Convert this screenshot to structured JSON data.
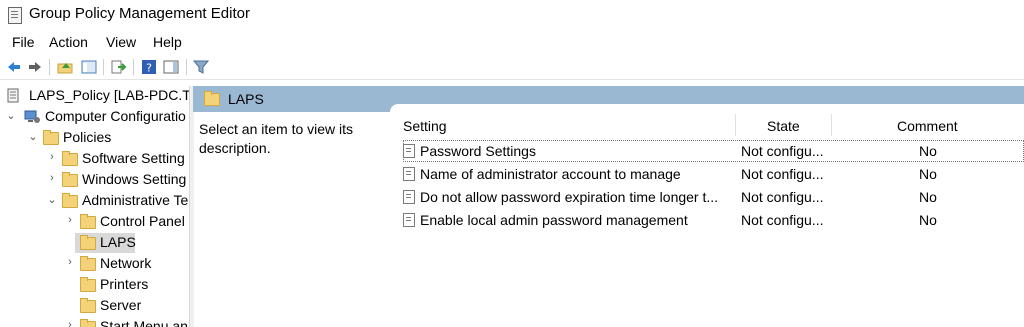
{
  "window": {
    "title": "Group Policy Management Editor"
  },
  "menu": [
    "File",
    "Action",
    "View",
    "Help"
  ],
  "toolbar": {
    "icons": [
      "back-arrow-icon",
      "forward-arrow-icon",
      "up-folder-icon",
      "show-hide-tree-icon",
      "export-list-icon",
      "help-icon",
      "show-hide-action-pane-icon",
      "filter-icon"
    ]
  },
  "tree": {
    "items": [
      {
        "label": "LAPS_Policy [LAB-PDC.TH",
        "chevron": ""
      },
      {
        "label": "Computer Configuratio",
        "chevron": "⌄"
      },
      {
        "label": "Policies",
        "chevron": "⌄"
      },
      {
        "label": "Software Setting",
        "chevron": "›"
      },
      {
        "label": "Windows Setting",
        "chevron": "›"
      },
      {
        "label": "Administrative Te",
        "chevron": "⌄"
      },
      {
        "label": "Control Panel",
        "chevron": "›"
      },
      {
        "label": "LAPS",
        "chevron": ""
      },
      {
        "label": "Network",
        "chevron": "›"
      },
      {
        "label": "Printers",
        "chevron": ""
      },
      {
        "label": "Server",
        "chevron": ""
      },
      {
        "label": "Start Menu an",
        "chevron": "›"
      }
    ]
  },
  "detail": {
    "header": "LAPS",
    "description": "Select an item to view its description.",
    "columns": {
      "setting": "Setting",
      "state": "State",
      "comment": "Comment"
    },
    "rows": [
      {
        "setting": "Password Settings",
        "state": "Not configu...",
        "comment": "No"
      },
      {
        "setting": "Name of administrator account to manage",
        "state": "Not configu...",
        "comment": "No"
      },
      {
        "setting": "Do not allow password expiration time longer t...",
        "state": "Not configu...",
        "comment": "No"
      },
      {
        "setting": "Enable local admin password management",
        "state": "Not configu...",
        "comment": "No"
      }
    ]
  },
  "colors": {
    "header_bg": "#9bb8d3",
    "folder": "#f3d27a",
    "selected": "#d9d9d9"
  }
}
